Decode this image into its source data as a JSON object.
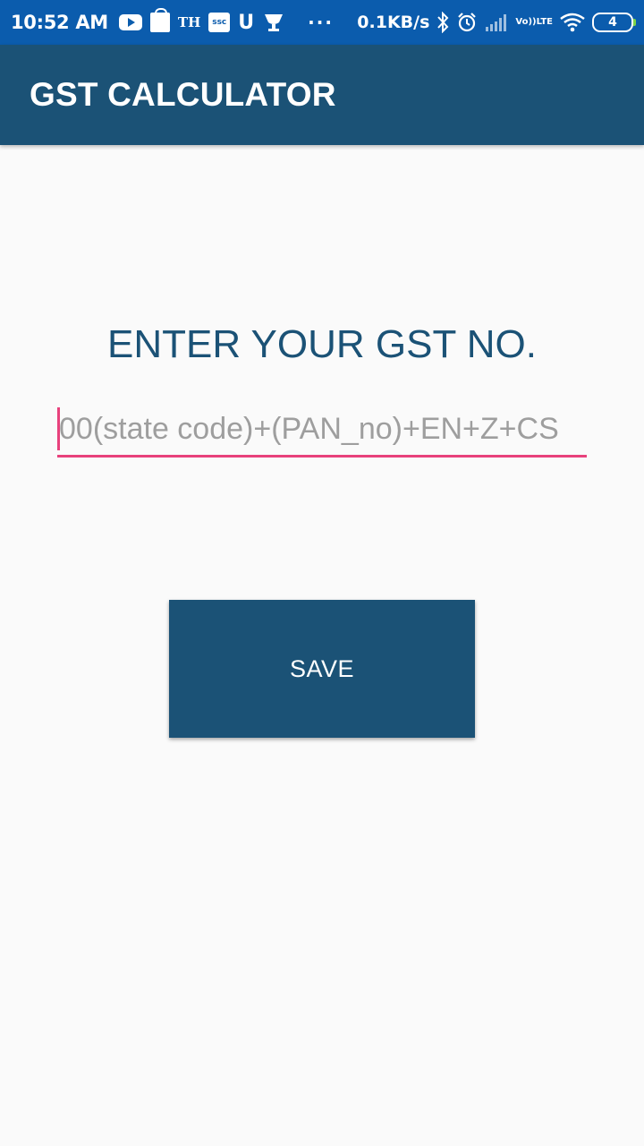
{
  "status_bar": {
    "time": "10:52 AM",
    "left_icons": [
      "youtube-icon",
      "shopping-bag-icon",
      "th-news-icon",
      "ssc-icon",
      "u-icon",
      "trophy-icon"
    ],
    "th_label": "TH",
    "ssc_label": "ssc",
    "u_label": "U",
    "more_indicator": "···",
    "net_speed": "0.1KB/s",
    "right_icons": [
      "bluetooth-icon",
      "alarm-icon",
      "signal-icon",
      "volte-icon",
      "wifi-icon",
      "battery-icon"
    ],
    "volte_line1": "Vo))",
    "volte_line2": "LTE",
    "battery_level": "4"
  },
  "app_bar": {
    "title": "GST CALCULATOR"
  },
  "main": {
    "prompt": "ENTER YOUR GST NO.",
    "gst_input": {
      "value": "",
      "placeholder": "00(state code)+(PAN_no)+EN+Z+CS"
    },
    "save_label": "SAVE"
  },
  "colors": {
    "status_bar": "#0b5cad",
    "primary": "#1b5276",
    "accent": "#e8417c",
    "background": "#fafafa",
    "hint_text": "#9e9e9e"
  }
}
